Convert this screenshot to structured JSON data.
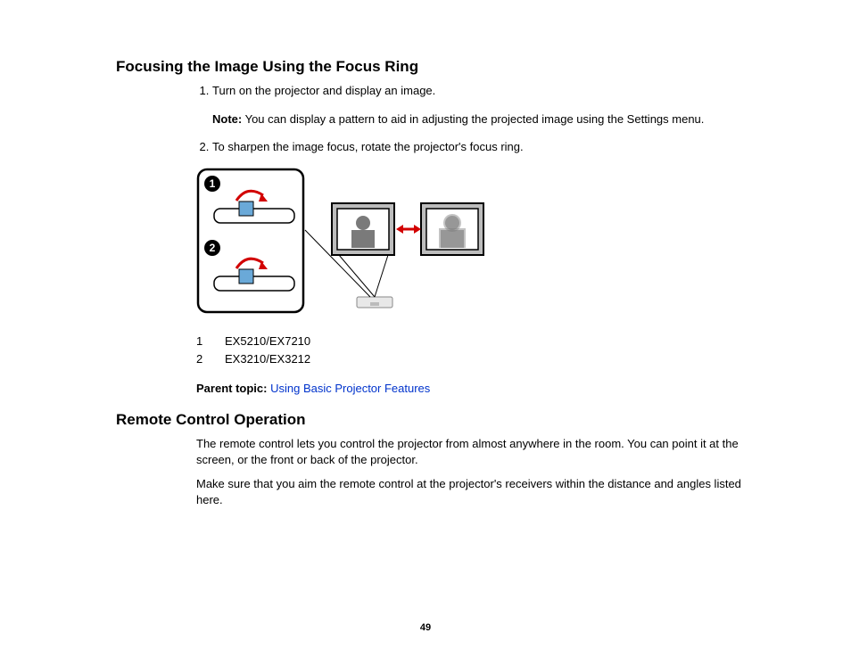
{
  "section1": {
    "heading": "Focusing the Image Using the Focus Ring",
    "step1": "Turn on the projector and display an image.",
    "noteLabel": "Note:",
    "noteText": " You can display a pattern to aid in adjusting the projected image using the Settings menu.",
    "step2": "To sharpen the image focus, rotate the projector's focus ring.",
    "legend": [
      {
        "num": "1",
        "text": "EX5210/EX7210"
      },
      {
        "num": "2",
        "text": "EX3210/EX3212"
      }
    ],
    "parentLabel": "Parent topic:",
    "parentLink": "Using Basic Projector Features"
  },
  "section2": {
    "heading": "Remote Control Operation",
    "para1": "The remote control lets you control the projector from almost anywhere in the room. You can point it at the screen, or the front or back of the projector.",
    "para2": "Make sure that you aim the remote control at the projector's receivers within the distance and angles listed here."
  },
  "pageNumber": "49"
}
